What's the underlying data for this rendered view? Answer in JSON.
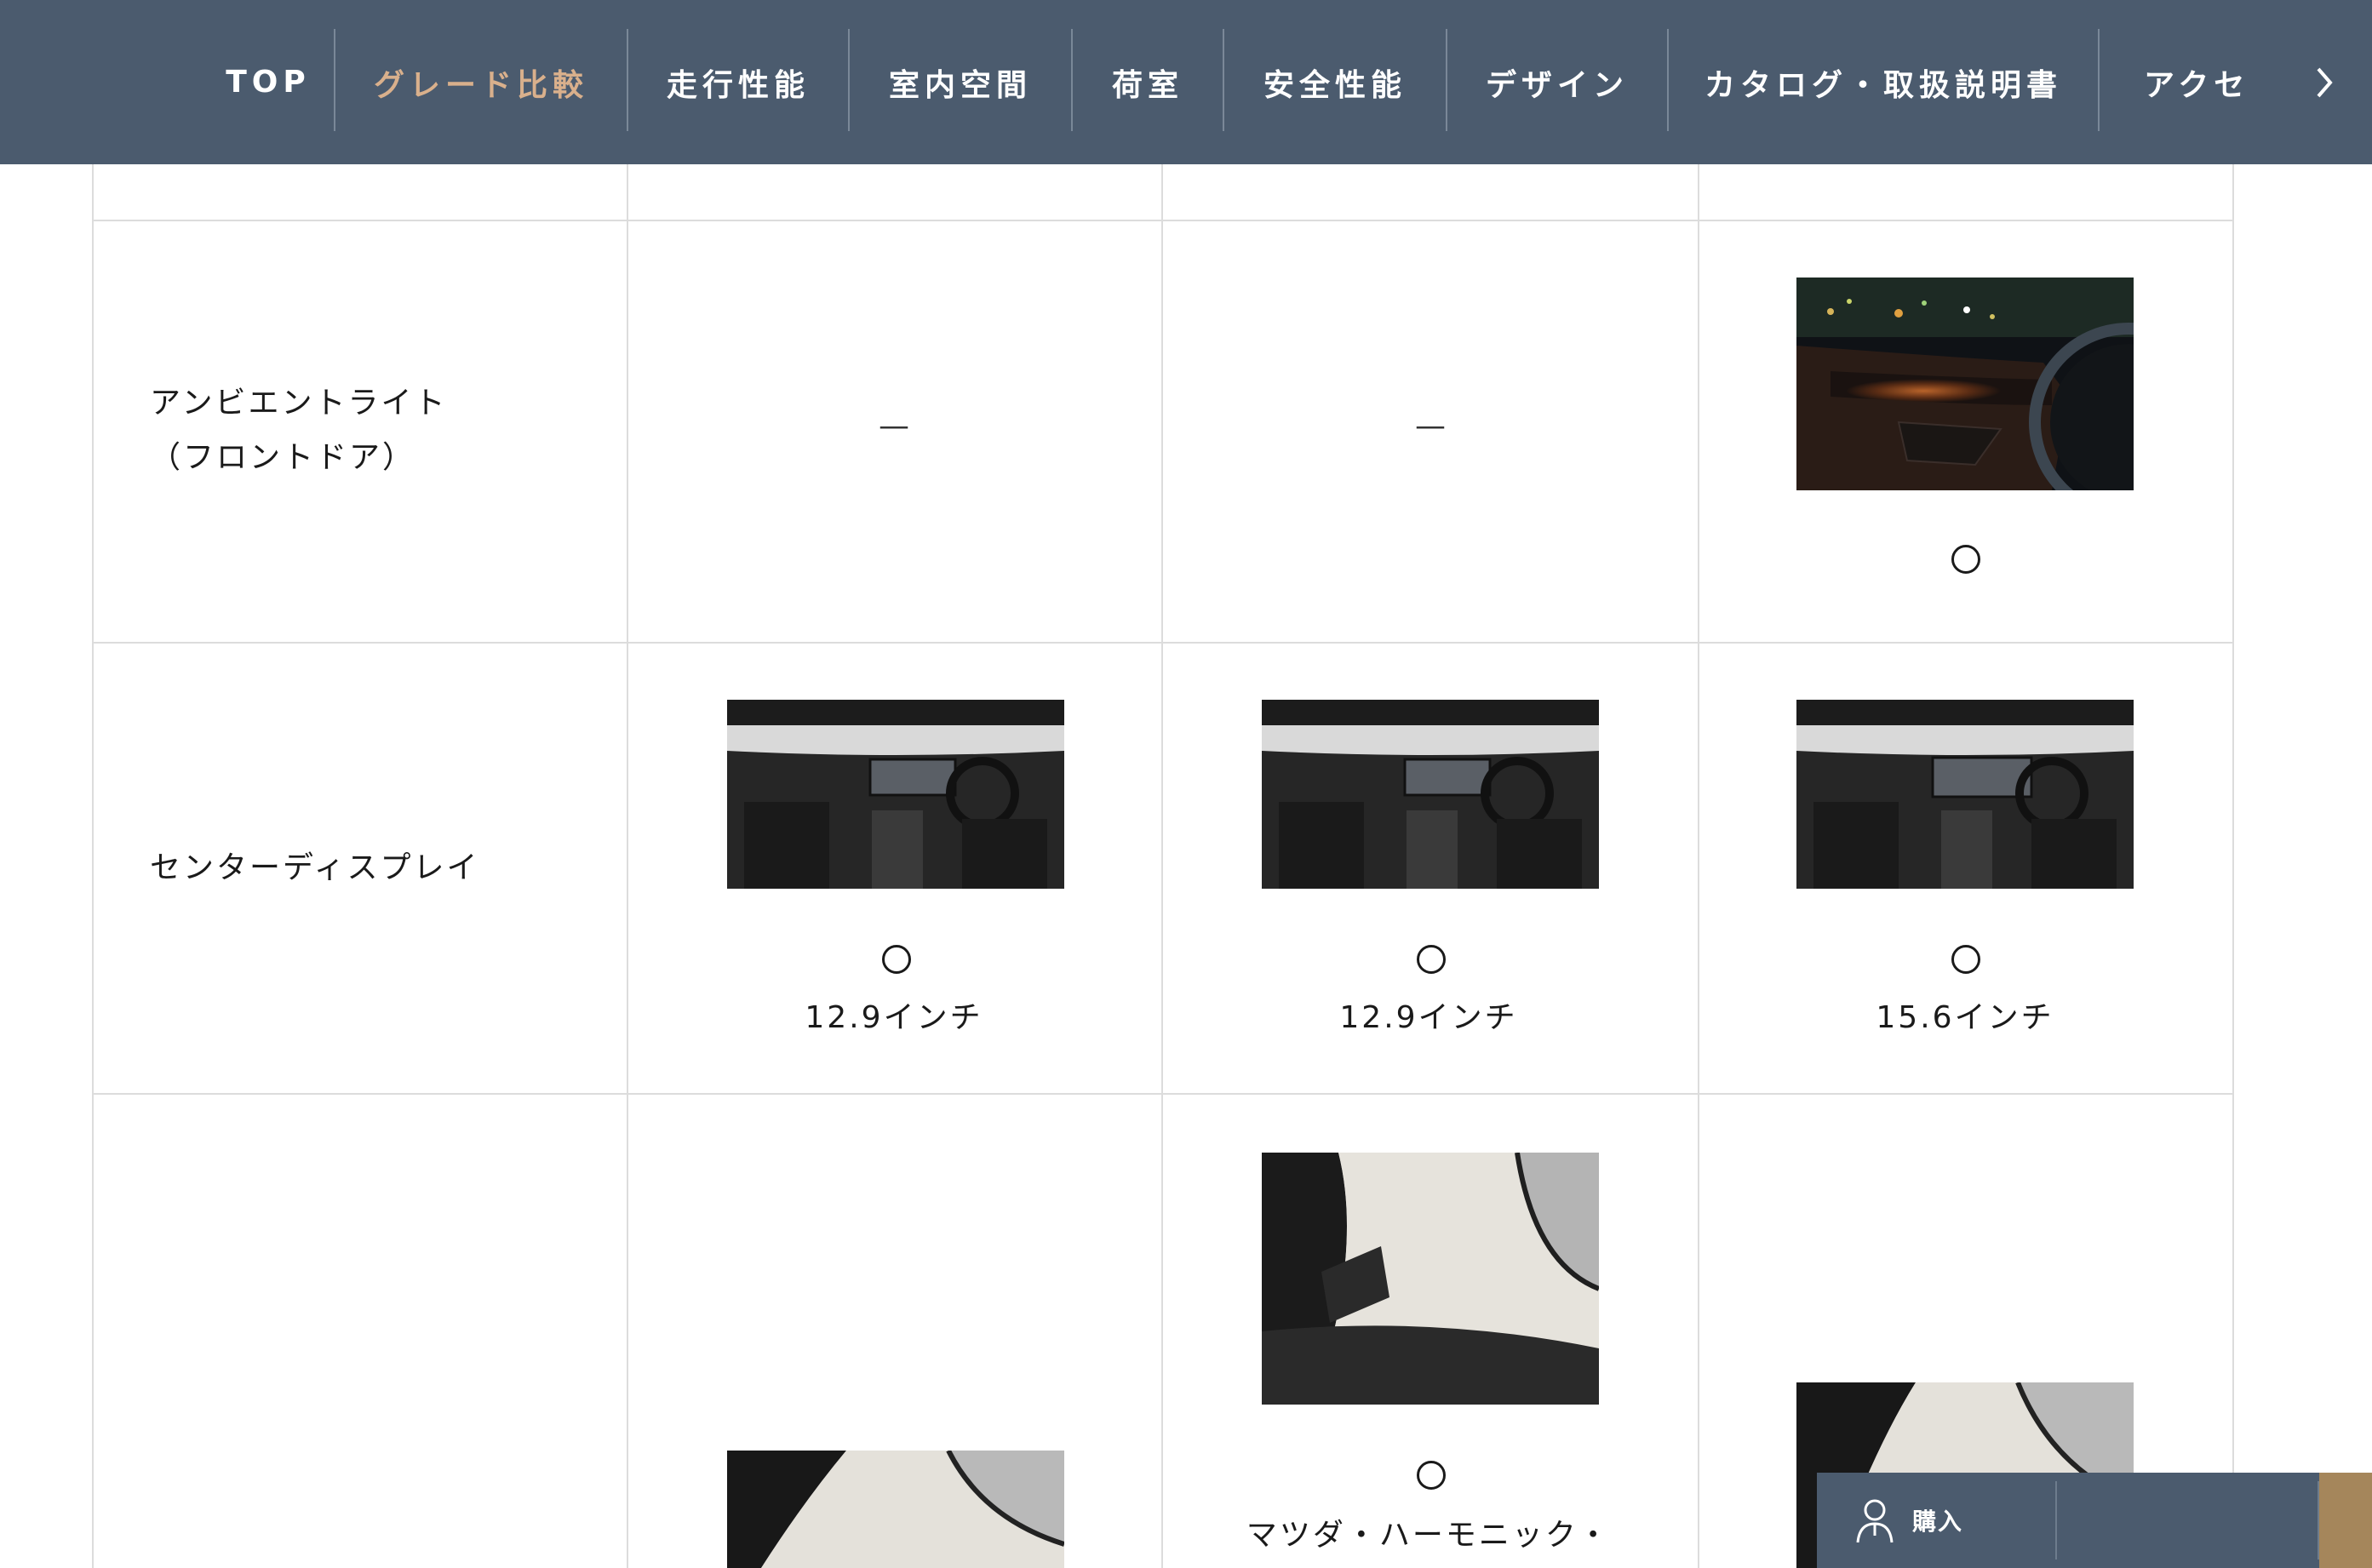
{
  "nav": {
    "items": [
      {
        "label": "TOP"
      },
      {
        "label": "グレード比較"
      },
      {
        "label": "走行性能"
      },
      {
        "label": "室内空間"
      },
      {
        "label": "荷室"
      },
      {
        "label": "安全性能"
      },
      {
        "label": "デザイン"
      },
      {
        "label": "カタログ・取扱説明書"
      },
      {
        "label": "アクセ"
      }
    ],
    "active_index": 1,
    "next_icon": "chevron-right-icon"
  },
  "table": {
    "rows": [
      {
        "label_line1": "アンビエントライト",
        "label_line2": "（フロントドア）",
        "cells": [
          {
            "value": "—"
          },
          {
            "value": "—"
          },
          {
            "value": "○",
            "image": "ambient-light-photo"
          }
        ]
      },
      {
        "label": "センターディスプレイ",
        "cells": [
          {
            "value": "○",
            "note": "12.9インチ",
            "image": "center-display-photo"
          },
          {
            "value": "○",
            "note": "12.9インチ",
            "image": "center-display-photo"
          },
          {
            "value": "○",
            "note": "15.6インチ",
            "image": "center-display-photo"
          }
        ]
      },
      {
        "label": "",
        "cells": [
          {
            "image": "a-pillar-speaker-photo"
          },
          {
            "value": "○",
            "note": "マツダ・ハーモニック・",
            "image": "a-pillar-speaker-photo"
          },
          {
            "image": "a-pillar-speaker-photo"
          }
        ]
      }
    ]
  },
  "floating_bar": {
    "buy_label": "購入",
    "buy_icon": "person-icon"
  },
  "colors": {
    "nav_bg": "#4b5b6e",
    "nav_active": "#d9b08c",
    "border": "#dcdcdc",
    "gold": "#a5865b"
  }
}
